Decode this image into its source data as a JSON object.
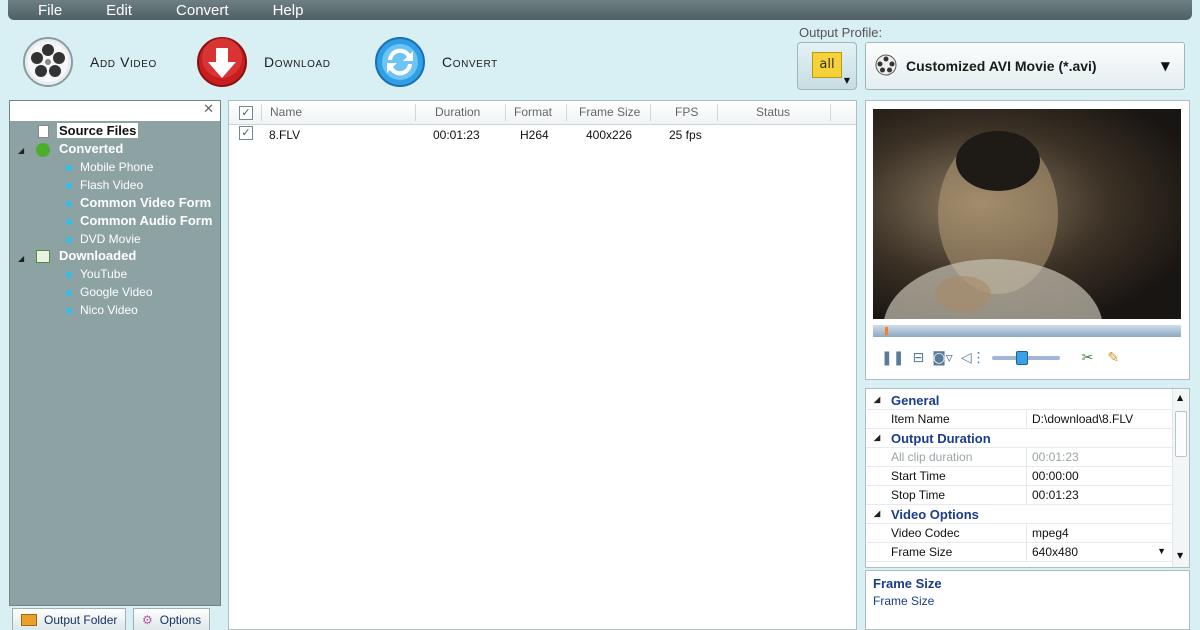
{
  "menu": [
    "File",
    "Edit",
    "Convert",
    "Help"
  ],
  "toolbar": {
    "add_video": "Add Video",
    "download": "Download",
    "convert": "Convert"
  },
  "output_profile": {
    "label": "Output Profile:",
    "all_button": "all",
    "selected": "Customized AVI Movie (*.avi)"
  },
  "tree": {
    "source_files": "Source Files",
    "converted": {
      "label": "Converted",
      "items": [
        "Mobile Phone",
        "Flash Video",
        "Common Video Form",
        "Common Audio Form",
        "DVD Movie"
      ]
    },
    "downloaded": {
      "label": "Downloaded",
      "items": [
        "YouTube",
        "Google Video",
        "Nico Video"
      ]
    }
  },
  "bottom_tabs": {
    "output_folder": "Output Folder",
    "options": "Options"
  },
  "file_list": {
    "columns": [
      "Name",
      "Duration",
      "Format",
      "Frame Size",
      "FPS",
      "Status"
    ],
    "rows": [
      {
        "checked": true,
        "name": "8.FLV",
        "duration": "00:01:23",
        "format": "H264",
        "frame_size": "400x226",
        "fps": "25 fps",
        "status": ""
      }
    ]
  },
  "properties": {
    "general": "General",
    "item_name_label": "Item Name",
    "item_name_value": "D:\\download\\8.FLV",
    "output_duration": "Output Duration",
    "all_clip_label": "All clip duration",
    "all_clip_value": "00:01:23",
    "start_label": "Start Time",
    "start_value": "00:00:00",
    "stop_label": "Stop Time",
    "stop_value": "00:01:23",
    "video_options": "Video Options",
    "codec_label": "Video Codec",
    "codec_value": "mpeg4",
    "frame_label": "Frame Size",
    "frame_value": "640x480"
  },
  "description": {
    "title": "Frame Size",
    "text": "Frame Size"
  },
  "player": {
    "progress": 0.04,
    "volume": 0.45
  }
}
